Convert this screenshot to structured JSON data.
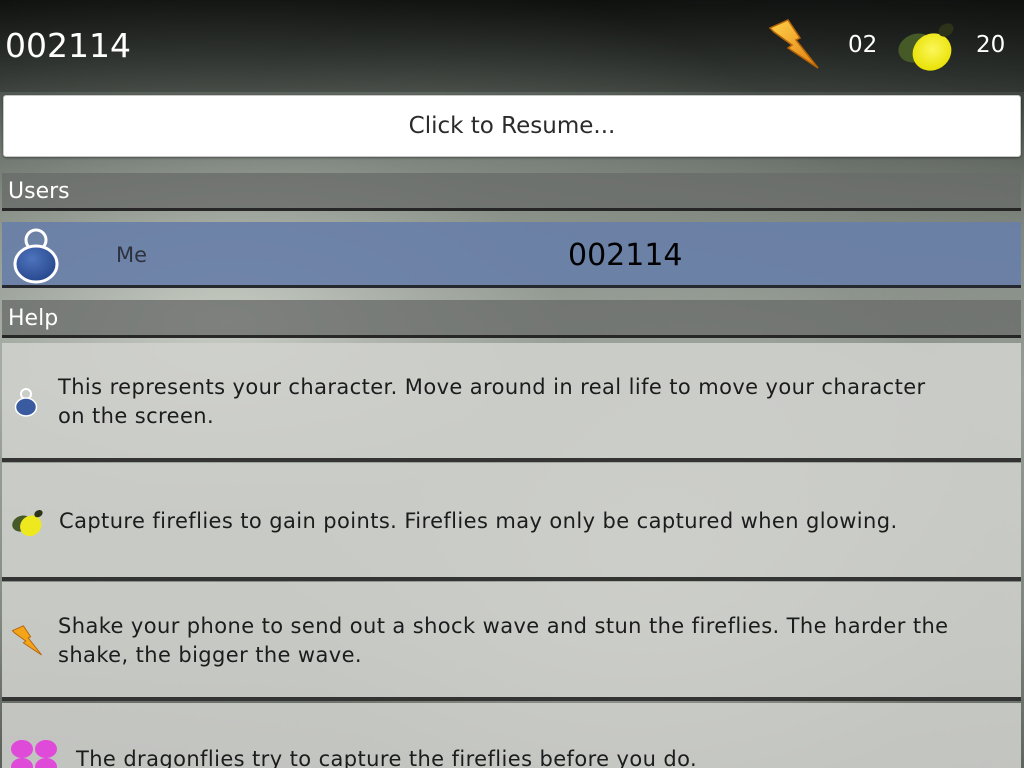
{
  "hud": {
    "score": "002114",
    "shock_count": "02",
    "firefly_count": "20"
  },
  "resume_label": "Click to Resume...",
  "users": {
    "header": "Users",
    "rows": [
      {
        "name": "Me",
        "score": "002114",
        "avatar_icon": "user-avatar-icon"
      }
    ]
  },
  "help": {
    "header": "Help",
    "items": [
      {
        "icon": "character-icon",
        "text": "This represents your character.  Move around in real life to move your character on the screen."
      },
      {
        "icon": "firefly-icon",
        "text": "Capture fireflies to gain points. Fireflies may only be captured when glowing."
      },
      {
        "icon": "lightning-icon",
        "text": "Shake your phone to send out a shock wave and stun the fireflies.  The harder the shake, the bigger the wave."
      },
      {
        "icon": "dragonfly-icon",
        "text": "The dragonflies try to capture the fireflies before you do."
      }
    ]
  },
  "colors": {
    "user_row": "#697fa8",
    "character": "#3a5ba0",
    "firefly_glow": "#f2ee1a",
    "lightning": "#f4a418",
    "dragonfly": "#e04ad8"
  }
}
